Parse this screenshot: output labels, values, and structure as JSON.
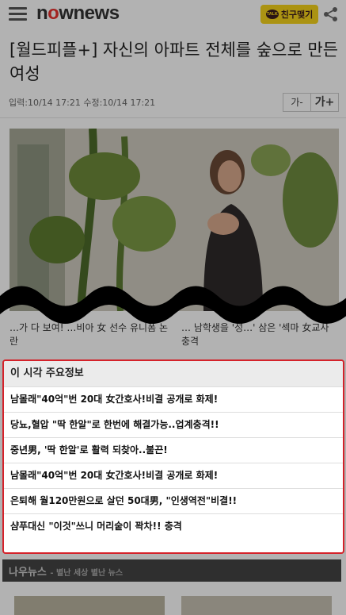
{
  "header": {
    "logo_text": "nownews",
    "kakao_label": "친구맺기",
    "kakao_badge": "TALK"
  },
  "article": {
    "title": "[월드피플+] 자신의 아파트 전체를 숲으로 만든 여성",
    "meta": "입력:10/14 17:21 수정:10/14 17:21",
    "font_small": "가-",
    "font_large": "가+"
  },
  "related": [
    {
      "caption": "…가 다 보여! …비아 女 선수 유니폼 논란"
    },
    {
      "caption": "… 남학생을 '성…' 삼은 '섹마 女교사 충격"
    }
  ],
  "popup": {
    "heading": "이 시각 주요정보",
    "items": [
      "남몰래\"40억\"번 20대 女간호사!비결 공개로 화제!",
      "당뇨,혈압 \"딱 한알\"로 한번에 해결가능..업계충격!!",
      "중년男, '딱 한알'로 활력 되찾아..불끈!",
      "남몰래\"40억\"번 20대 女간호사!비결 공개로 화제!",
      "은퇴해 월120만원으로 살던 50대男, \"인생역전\"비결!!",
      "샴푸대신 \"이것\"쓰니 머리숱이 꽉차!! 충격"
    ]
  },
  "section": {
    "name": "나우뉴스",
    "sub": "- 별난 세상 별난 뉴스"
  },
  "colors": {
    "accent": "#d4222a",
    "logo_red": "#e8312f",
    "kakao": "#f5d31c"
  }
}
